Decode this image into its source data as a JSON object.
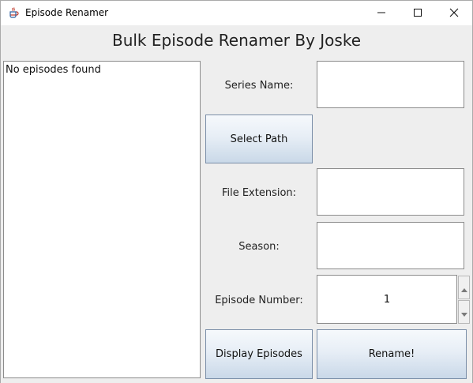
{
  "window": {
    "title": "Episode Renamer",
    "controls": {
      "minimize_icon": "minimize-icon",
      "maximize_icon": "maximize-icon",
      "close_icon": "close-icon"
    }
  },
  "heading": "Bulk Episode Renamer By Joske",
  "episode_list": {
    "empty_text": "No episodes found"
  },
  "form": {
    "series_name": {
      "label": "Series Name:",
      "value": ""
    },
    "select_path_button": "Select Path",
    "file_extension": {
      "label": "File Extension:",
      "value": ""
    },
    "season": {
      "label": "Season:",
      "value": ""
    },
    "episode_number": {
      "label": "Episode Number:",
      "value": "1"
    },
    "display_episodes_button": "Display Episodes",
    "rename_button": "Rename!"
  }
}
